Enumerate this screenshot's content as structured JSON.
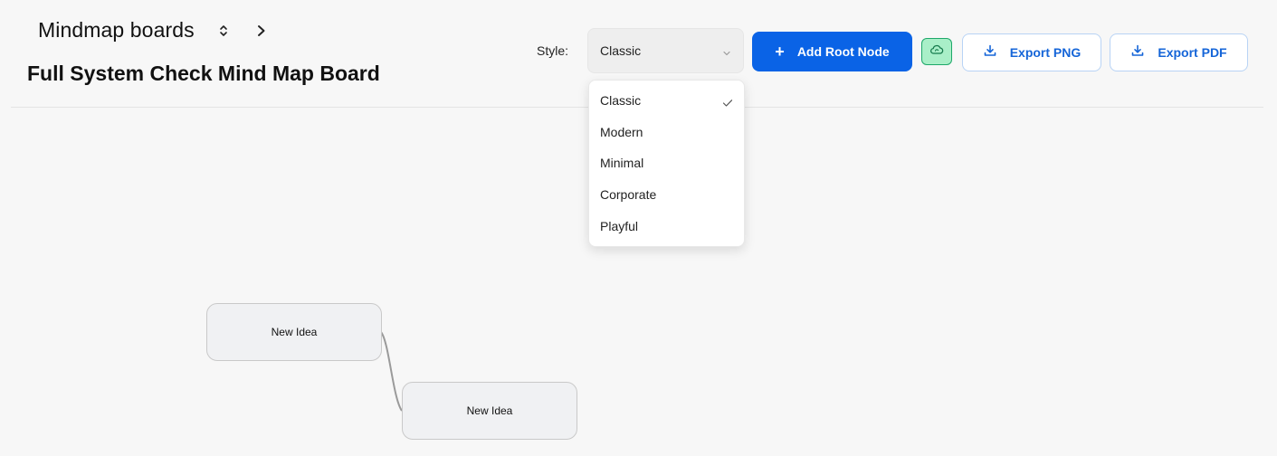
{
  "breadcrumb": {
    "label": "Mindmap boards"
  },
  "board": {
    "title": "Full System Check Mind Map Board"
  },
  "toolbar": {
    "style_label": "Style:",
    "style_selected": "Classic",
    "add_root_label": "Add Root Node",
    "export_png_label": "Export PNG",
    "export_pdf_label": "Export PDF"
  },
  "style_options": [
    "Classic",
    "Modern",
    "Minimal",
    "Corporate",
    "Playful"
  ],
  "nodes": [
    {
      "label": "New Idea"
    },
    {
      "label": "New Idea"
    }
  ],
  "icons": {
    "switcher": "chevron-up-down-icon",
    "breadcrumb_sep": "chevron-right-icon",
    "select_caret": "chevron-down-icon",
    "add": "plus-icon",
    "cloud": "cloud-sync-icon",
    "download": "download-icon",
    "check": "check-icon"
  },
  "colors": {
    "primary": "#0a63e6",
    "outline_text": "#1565d8",
    "cloud_bg": "#a9efc8",
    "cloud_border": "#1ea86a"
  }
}
